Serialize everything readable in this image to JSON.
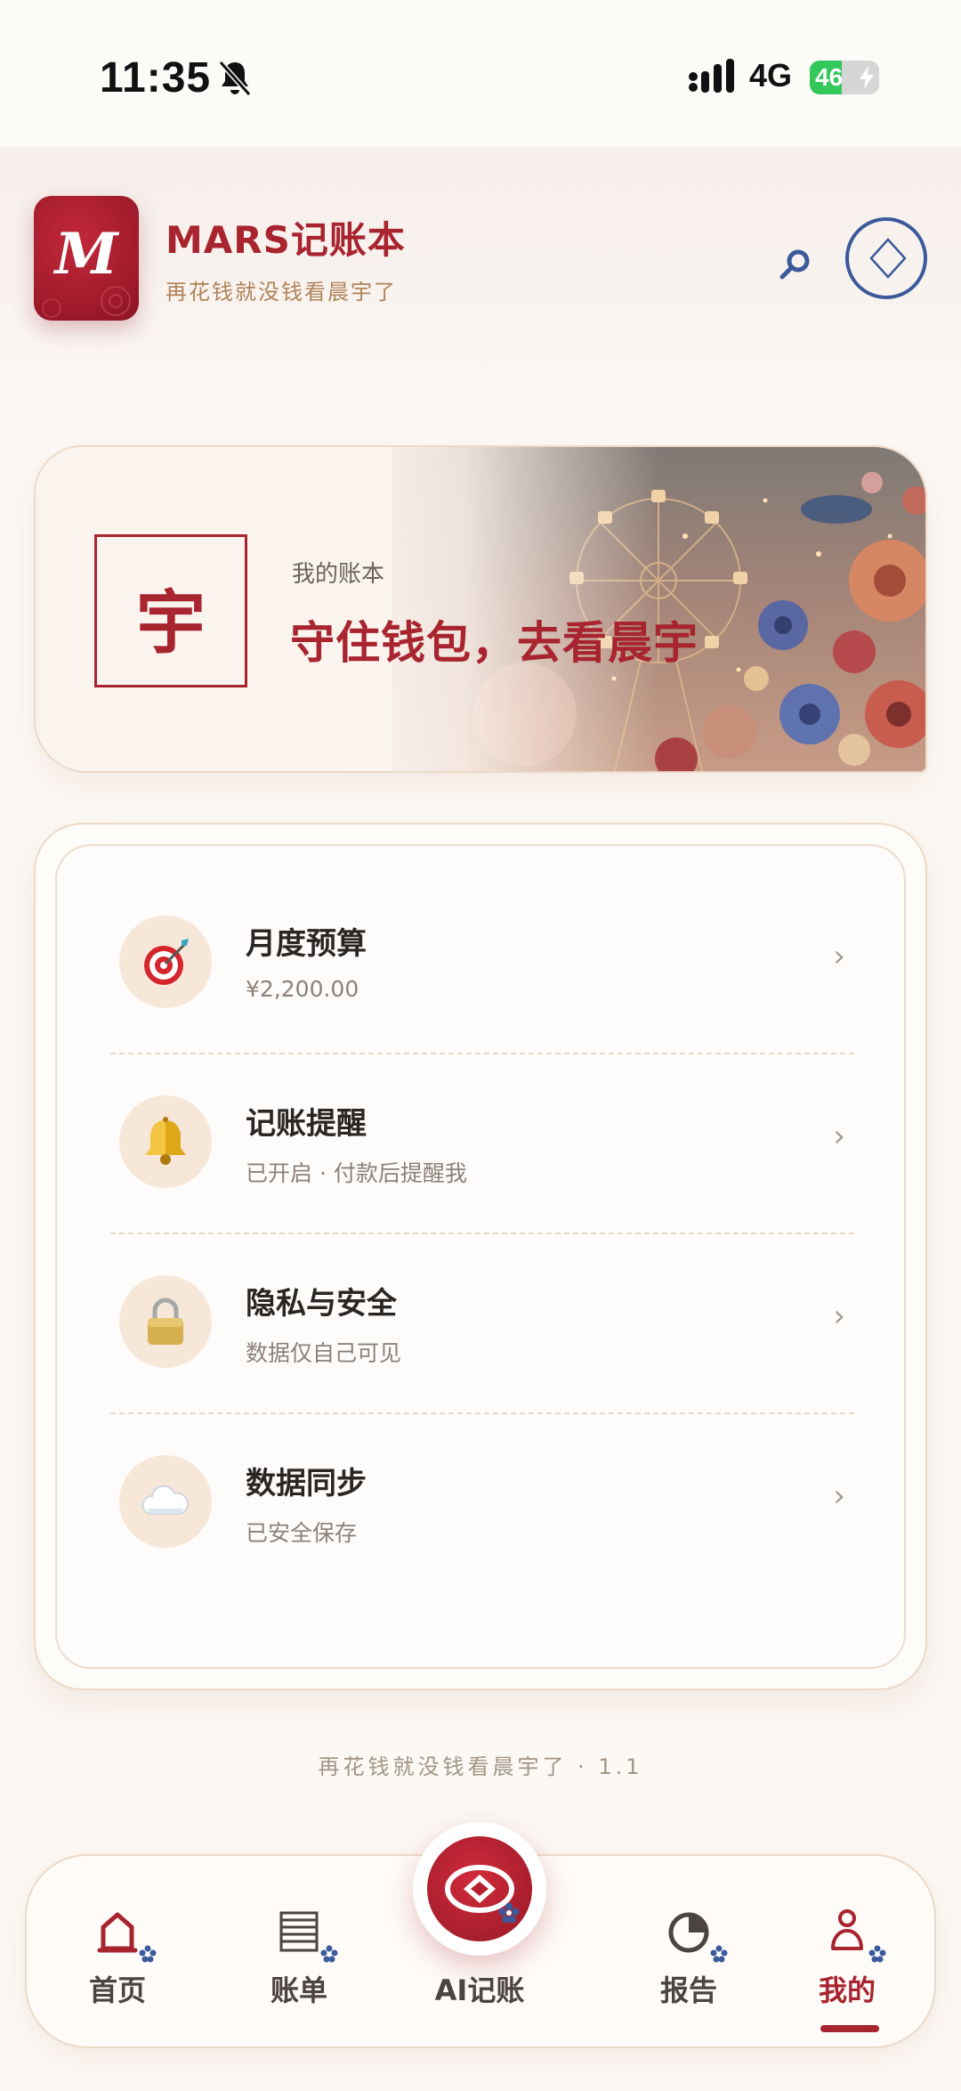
{
  "status_bar": {
    "time": "11:35",
    "network": "4G",
    "battery": "46",
    "battery_level": 0.46
  },
  "header": {
    "logo_letter": "M",
    "title": "MARS记账本",
    "subtitle": "再花钱就没钱看晨宇了"
  },
  "banner": {
    "seal_char": "宇",
    "label": "我的账本",
    "title": "守住钱包，去看晨宇"
  },
  "settings": {
    "items": [
      {
        "title": "月度预算",
        "subtitle": "¥2,200.00",
        "icon": "target-icon"
      },
      {
        "title": "记账提醒",
        "subtitle": "已开启 · 付款后提醒我",
        "icon": "bell-icon"
      },
      {
        "title": "隐私与安全",
        "subtitle": "数据仅自己可见",
        "icon": "lock-icon"
      },
      {
        "title": "数据同步",
        "subtitle": "已安全保存",
        "icon": "cloud-icon"
      }
    ]
  },
  "footer": {
    "note": "再花钱就没钱看晨宇了 · 1.1"
  },
  "nav": {
    "items": [
      {
        "label": "首页",
        "icon": "home-icon"
      },
      {
        "label": "账单",
        "icon": "bill-icon"
      },
      {
        "label": "AI记账",
        "icon": "ai-icon"
      },
      {
        "label": "报告",
        "icon": "pie-chart-icon"
      },
      {
        "label": "我的",
        "icon": "profile-icon"
      }
    ],
    "active": "我的"
  },
  "colors": {
    "accent": "#a8242f",
    "gold": "#b08358",
    "blue": "#3b5a9b",
    "background": "#fcf8f4"
  }
}
